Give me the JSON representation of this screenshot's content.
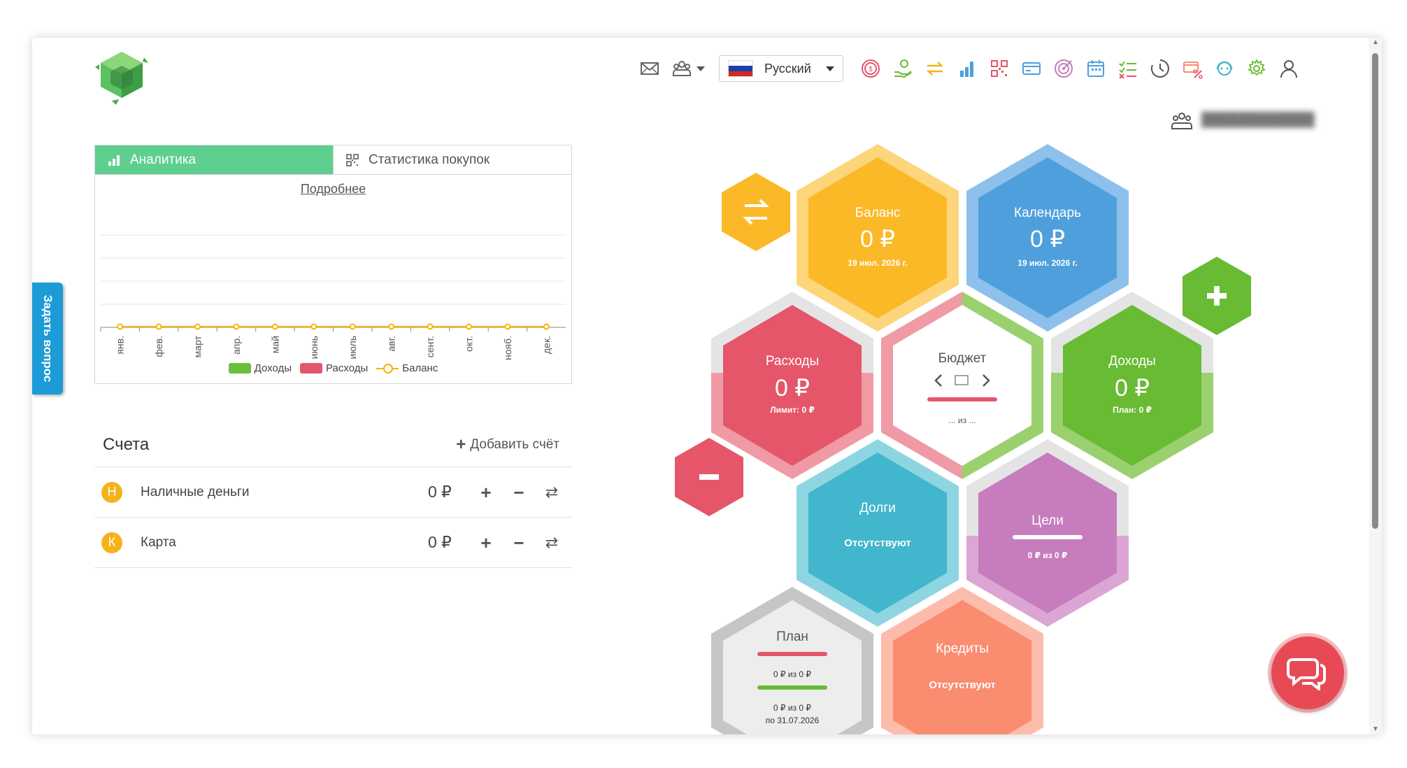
{
  "ask_question": "Задать вопрос",
  "language": {
    "selected": "Русский"
  },
  "analytics": {
    "tabs": [
      {
        "label": "Аналитика"
      },
      {
        "label": "Статистика покупок"
      }
    ],
    "more_link": "Подробнее"
  },
  "chart_data": {
    "type": "line",
    "categories": [
      "янв.",
      "фев.",
      "март",
      "апр.",
      "май",
      "июнь",
      "июль",
      "авг.",
      "сент.",
      "окт.",
      "нояб.",
      "дек."
    ],
    "series": [
      {
        "name": "Доходы",
        "type": "bar",
        "color": "#6cbf3a",
        "values": [
          0,
          0,
          0,
          0,
          0,
          0,
          0,
          0,
          0,
          0,
          0,
          0
        ]
      },
      {
        "name": "Расходы",
        "type": "bar",
        "color": "#e5566a",
        "values": [
          0,
          0,
          0,
          0,
          0,
          0,
          0,
          0,
          0,
          0,
          0,
          0
        ]
      },
      {
        "name": "Баланс",
        "type": "line",
        "color": "#f5b400",
        "values": [
          0,
          0,
          0,
          0,
          0,
          0,
          0,
          0,
          0,
          0,
          0,
          0
        ]
      }
    ],
    "ylim": [
      0,
      1
    ],
    "grid": true,
    "legend": "bottom"
  },
  "accounts": {
    "title": "Счета",
    "add_label": "Добавить счёт",
    "items": [
      {
        "badge": "Н",
        "name": "Наличные деньги",
        "amount": "0 ₽"
      },
      {
        "badge": "К",
        "name": "Карта",
        "amount": "0 ₽"
      }
    ]
  },
  "hexes": {
    "balance": {
      "title": "Баланс",
      "amount": "0 ₽",
      "date": "19 июл. 2026 г.",
      "color": "#fbb928"
    },
    "calendar": {
      "title": "Календарь",
      "amount": "0 ₽",
      "date": "19 июл. 2026 г.",
      "color": "#4f9fdc"
    },
    "expenses": {
      "title": "Расходы",
      "amount": "0 ₽",
      "sub": "Лимит: 0 ₽",
      "color": "#e5566a"
    },
    "budget": {
      "title": "Бюджет",
      "sub": "... из ..."
    },
    "income": {
      "title": "Доходы",
      "amount": "0 ₽",
      "sub": "План: 0 ₽",
      "color": "#68bb32"
    },
    "debts": {
      "title": "Долги",
      "sub": "Отсутствуют",
      "color": "#42b6cc"
    },
    "goals": {
      "title": "Цели",
      "sub": "0 ₽ из 0 ₽",
      "color": "#c67cbd"
    },
    "plan": {
      "title": "План",
      "line1": "0 ₽ из 0 ₽",
      "line2": "0 ₽ из 0 ₽",
      "date": "по 31.07.2026"
    },
    "credits": {
      "title": "Кредиты",
      "sub": "Отсутствуют",
      "color": "#fa8c70"
    }
  },
  "icons": {
    "toolbar": [
      "mail-icon",
      "users-icon",
      "coins-icon",
      "hand-money-icon",
      "transfer-icon",
      "bar-chart-icon",
      "qr-code-icon",
      "card-icon",
      "target-icon",
      "calendar-icon",
      "checklist-icon",
      "clock-icon",
      "discount-card-icon",
      "support-icon",
      "settings-icon",
      "user-icon"
    ]
  }
}
